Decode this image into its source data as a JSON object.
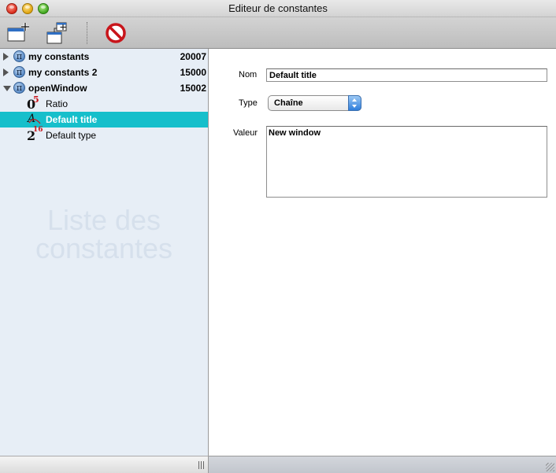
{
  "window": {
    "title": "Editeur de constantes"
  },
  "toolbar": {
    "buttons": [
      {
        "icon": "new-window-add-icon"
      },
      {
        "icon": "add-constant-icon"
      },
      {
        "icon": "delete-icon"
      }
    ]
  },
  "sidebar": {
    "groups": [
      {
        "label": "my constants",
        "number": "20007",
        "expanded": false
      },
      {
        "label": "my constants 2",
        "number": "15000",
        "expanded": false
      },
      {
        "label": "openWindow",
        "number": "15002",
        "expanded": true
      }
    ],
    "children": [
      {
        "label": "Ratio",
        "type": "number",
        "icon_main": "0",
        "icon_sup": "5"
      },
      {
        "label": "Default title",
        "type": "string",
        "selected": true,
        "icon_main": "A",
        "icon_sup": ""
      },
      {
        "label": "Default type",
        "type": "integer",
        "icon_main": "2",
        "icon_sup": "16"
      }
    ],
    "watermark_line1": "Liste des",
    "watermark_line2": "constantes",
    "selection_color": "#16bfcb"
  },
  "editor": {
    "name_label": "Nom",
    "name_value": "Default title",
    "type_label": "Type",
    "type_value": "Chaîne",
    "value_label": "Valeur",
    "value_text": "New window"
  }
}
